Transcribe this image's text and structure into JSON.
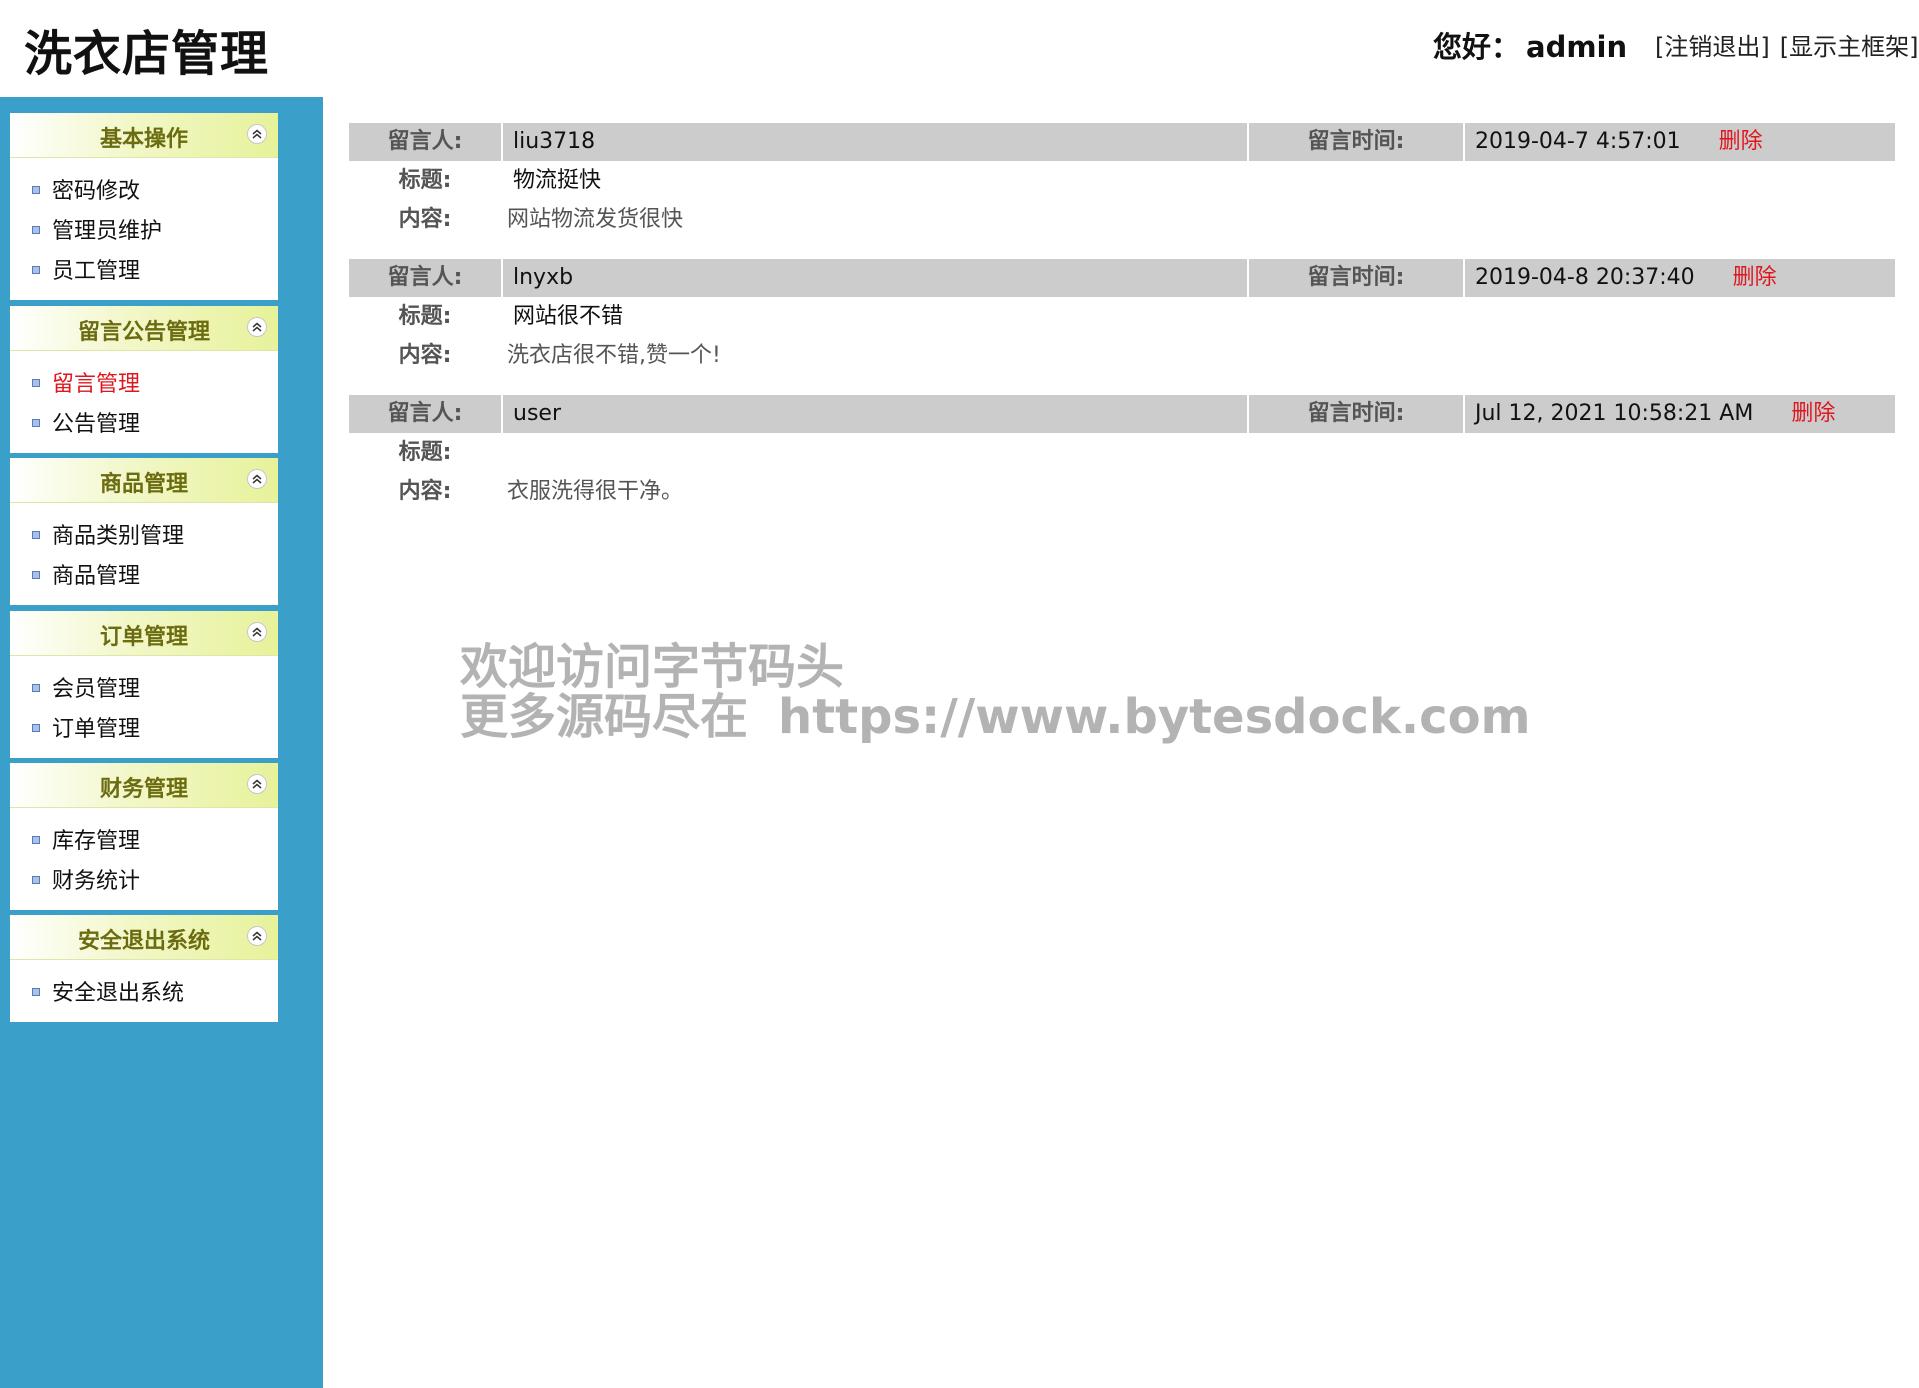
{
  "header": {
    "title": "洗衣店管理",
    "greeting_label": "您好：",
    "username": "admin",
    "logout_link": "[注销退出]",
    "show_frame_link": "[显示主框架]"
  },
  "sidebar": {
    "groups": [
      {
        "title": "基本操作",
        "items": [
          "密码修改",
          "管理员维护",
          "员工管理"
        ]
      },
      {
        "title": "留言公告管理",
        "items": [
          "留言管理",
          "公告管理"
        ]
      },
      {
        "title": "商品管理",
        "items": [
          "商品类别管理",
          "商品管理"
        ]
      },
      {
        "title": "订单管理",
        "items": [
          "会员管理",
          "订单管理"
        ]
      },
      {
        "title": "财务管理",
        "items": [
          "库存管理",
          "财务统计"
        ]
      },
      {
        "title": "安全退出系统",
        "items": [
          "安全退出系统"
        ]
      }
    ],
    "active_item": "留言管理"
  },
  "labels": {
    "author": "留言人:",
    "time": "留言时间:",
    "title": "标题:",
    "content": "内容:",
    "delete": "删除"
  },
  "messages": [
    {
      "author": "liu3718",
      "time": "2019-04-7 4:57:01",
      "title": "物流挺快",
      "content": "网站物流发货很快"
    },
    {
      "author": "lnyxb",
      "time": "2019-04-8 20:37:40",
      "title": "网站很不错",
      "content": "洗衣店很不错,赞一个!"
    },
    {
      "author": "user",
      "time": "Jul 12, 2021 10:58:21 AM",
      "title": "",
      "content": "衣服洗得很干净。"
    }
  ],
  "watermark": {
    "line1": "欢迎访问字节码头",
    "line2_prefix": "更多源码尽在",
    "line2_url": "https://www.bytesdock.com"
  },
  "colors": {
    "sidebar_bg": "#3ba0c9",
    "menu_head_text": "#6b6b10",
    "active_red": "#e0161e",
    "row_header_bg": "#cccccc"
  }
}
